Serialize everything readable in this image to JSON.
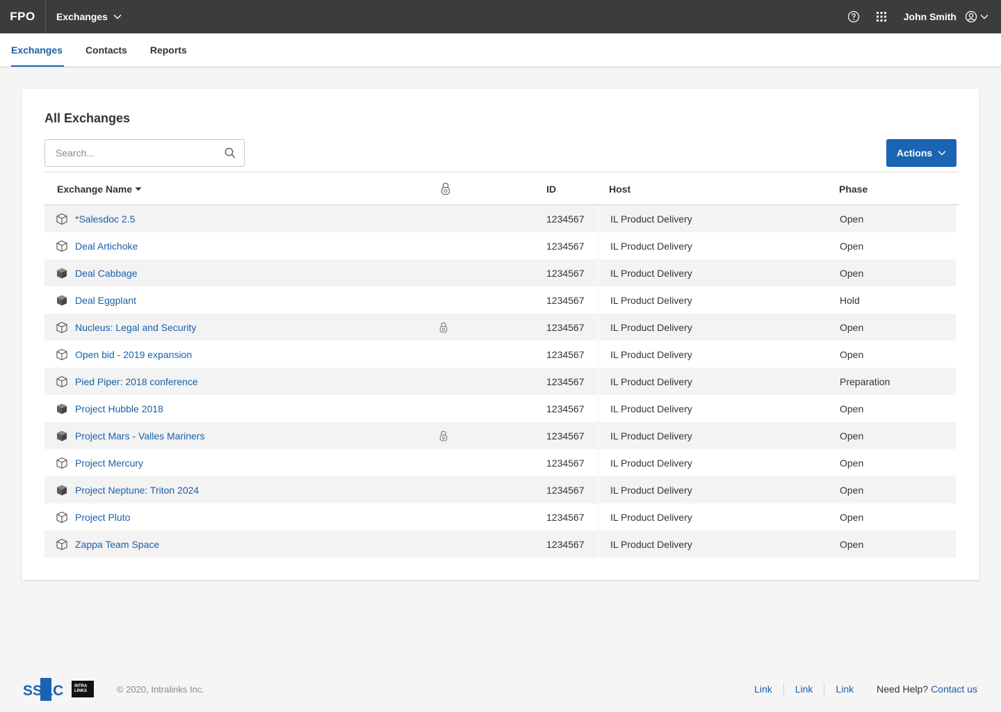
{
  "header": {
    "logo": "FPO",
    "app_switcher": "Exchanges",
    "user_name": "John Smith"
  },
  "tabs": [
    {
      "label": "Exchanges",
      "active": true
    },
    {
      "label": "Contacts",
      "active": false
    },
    {
      "label": "Reports",
      "active": false
    }
  ],
  "main": {
    "title": "All Exchanges",
    "search": {
      "placeholder": "Search...",
      "value": ""
    },
    "actions_label": "Actions",
    "columns": {
      "name": "Exchange Name",
      "id": "ID",
      "host": "Host",
      "phase": "Phase"
    },
    "rows": [
      {
        "name": "*Salesdoc 2.5",
        "id": "1234567",
        "host": "IL Product Delivery",
        "phase": "Open",
        "icon": "outline",
        "locked": false
      },
      {
        "name": "Deal Artichoke",
        "id": "1234567",
        "host": "IL Product Delivery",
        "phase": "Open",
        "icon": "outline",
        "locked": false
      },
      {
        "name": "Deal Cabbage",
        "id": "1234567",
        "host": "IL Product Delivery",
        "phase": "Open",
        "icon": "filled",
        "locked": false
      },
      {
        "name": "Deal Eggplant",
        "id": "1234567",
        "host": "IL Product Delivery",
        "phase": "Hold",
        "icon": "filled",
        "locked": false
      },
      {
        "name": "Nucleus: Legal and Security",
        "id": "1234567",
        "host": "IL Product Delivery",
        "phase": "Open",
        "icon": "outline",
        "locked": true
      },
      {
        "name": "Open bid - 2019 expansion",
        "id": "1234567",
        "host": "IL Product Delivery",
        "phase": "Open",
        "icon": "outline",
        "locked": false
      },
      {
        "name": "Pied Piper: 2018 conference",
        "id": "1234567",
        "host": "IL Product Delivery",
        "phase": "Preparation",
        "icon": "outline",
        "locked": false
      },
      {
        "name": "Project Hubble 2018",
        "id": "1234567",
        "host": "IL Product Delivery",
        "phase": "Open",
        "icon": "filled",
        "locked": false
      },
      {
        "name": "Project Mars - Valles Mariners",
        "id": "1234567",
        "host": "IL Product Delivery",
        "phase": "Open",
        "icon": "filled",
        "locked": true
      },
      {
        "name": "Project Mercury",
        "id": "1234567",
        "host": "IL Product Delivery",
        "phase": "Open",
        "icon": "outline",
        "locked": false
      },
      {
        "name": "Project Neptune: Triton 2024",
        "id": "1234567",
        "host": "IL Product Delivery",
        "phase": "Open",
        "icon": "filled",
        "locked": false
      },
      {
        "name": "Project Pluto",
        "id": "1234567",
        "host": "IL Product Delivery",
        "phase": "Open",
        "icon": "outline",
        "locked": false
      },
      {
        "name": "Zappa Team Space",
        "id": "1234567",
        "host": "IL Product Delivery",
        "phase": "Open",
        "icon": "outline",
        "locked": false
      }
    ]
  },
  "footer": {
    "brand": "SS&C",
    "partner_line1": "INTRA",
    "partner_line2": "LINKS",
    "copyright": "© 2020, Intralinks Inc.",
    "links": [
      "Link",
      "Link",
      "Link"
    ],
    "help_text": "Need Help?",
    "contact_label": "Contact us"
  },
  "colors": {
    "topbar": "#3c3c3c",
    "accent": "#1a5fa8",
    "button": "#1b63b3",
    "row_stripe": "#f3f3f3"
  }
}
